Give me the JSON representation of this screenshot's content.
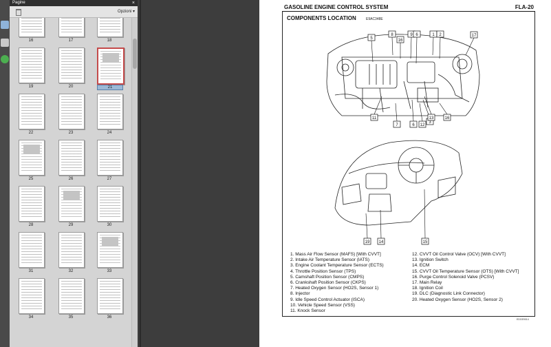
{
  "panel": {
    "title": "Pagine",
    "close_glyph": "×",
    "options_label": "Opzioni ▾"
  },
  "thumbnails": [
    {
      "page": "16"
    },
    {
      "page": "17"
    },
    {
      "page": "18"
    },
    {
      "page": "19"
    },
    {
      "page": "20"
    },
    {
      "page": "21",
      "selected": true
    },
    {
      "page": "22"
    },
    {
      "page": "23"
    },
    {
      "page": "24"
    },
    {
      "page": "25"
    },
    {
      "page": "26"
    },
    {
      "page": "27"
    },
    {
      "page": "28"
    },
    {
      "page": "29"
    },
    {
      "page": "30"
    },
    {
      "page": "31"
    },
    {
      "page": "32"
    },
    {
      "page": "33"
    },
    {
      "page": "34"
    },
    {
      "page": "35"
    },
    {
      "page": "36"
    }
  ],
  "document": {
    "header_left": "GASOLINE ENGINE CONTROL SYSTEM",
    "header_right": "FLA-20",
    "section_title": "COMPONENTS LOCATION",
    "section_code": "E9AC348E",
    "footer_code": "EDGE9014",
    "callouts_top": [
      "5",
      "8",
      "9",
      "6",
      "1",
      "2",
      "17",
      "16",
      "3",
      "11",
      "7",
      "6",
      "12",
      "13",
      "16"
    ],
    "callouts_bottom": [
      "19",
      "14",
      "15"
    ],
    "legend_left": [
      "1.  Mass Air Flow Sensor (MAFS) [With CVVT]",
      "2.  Intake Air Temperature Sensor (IATS)",
      "3.  Engine Coolant Temperature Sensor (ECTS)",
      "4.  Throttle Position Sensor (TPS)",
      "5.  Camshaft Position Sensor (CMPS)",
      "6.  Crankshaft Position Sensor (CKPS)",
      "7.  Heated Oxygen Sensor (HO2S, Sensor 1)",
      "8.  Injector",
      "9.  Idle Speed Control Actuator (ISCA)",
      "10.  Vehicle Speed Sensor (VSS)",
      "11.  Knock Sensor"
    ],
    "legend_right": [
      "12.  CVVT Oil Control Valve (OCV) [With CVVT]",
      "13.  Ignition Switch",
      "14.  ECM",
      "15.  CVVT Oil Temperature Sensor (OTS) [With CVVT]",
      "16.  Purge Control Solenoid Valve (PCSV)",
      "17.  Main Relay",
      "18.  Ignition Coil",
      "19.  DLC (Diagnostic Link Connector)",
      "20.  Heated Oxygen Sensor (HO2S, Sensor 2)"
    ]
  },
  "icons": [
    "pages-icon",
    "edit-icon",
    "help-icon",
    "trash-icon"
  ]
}
